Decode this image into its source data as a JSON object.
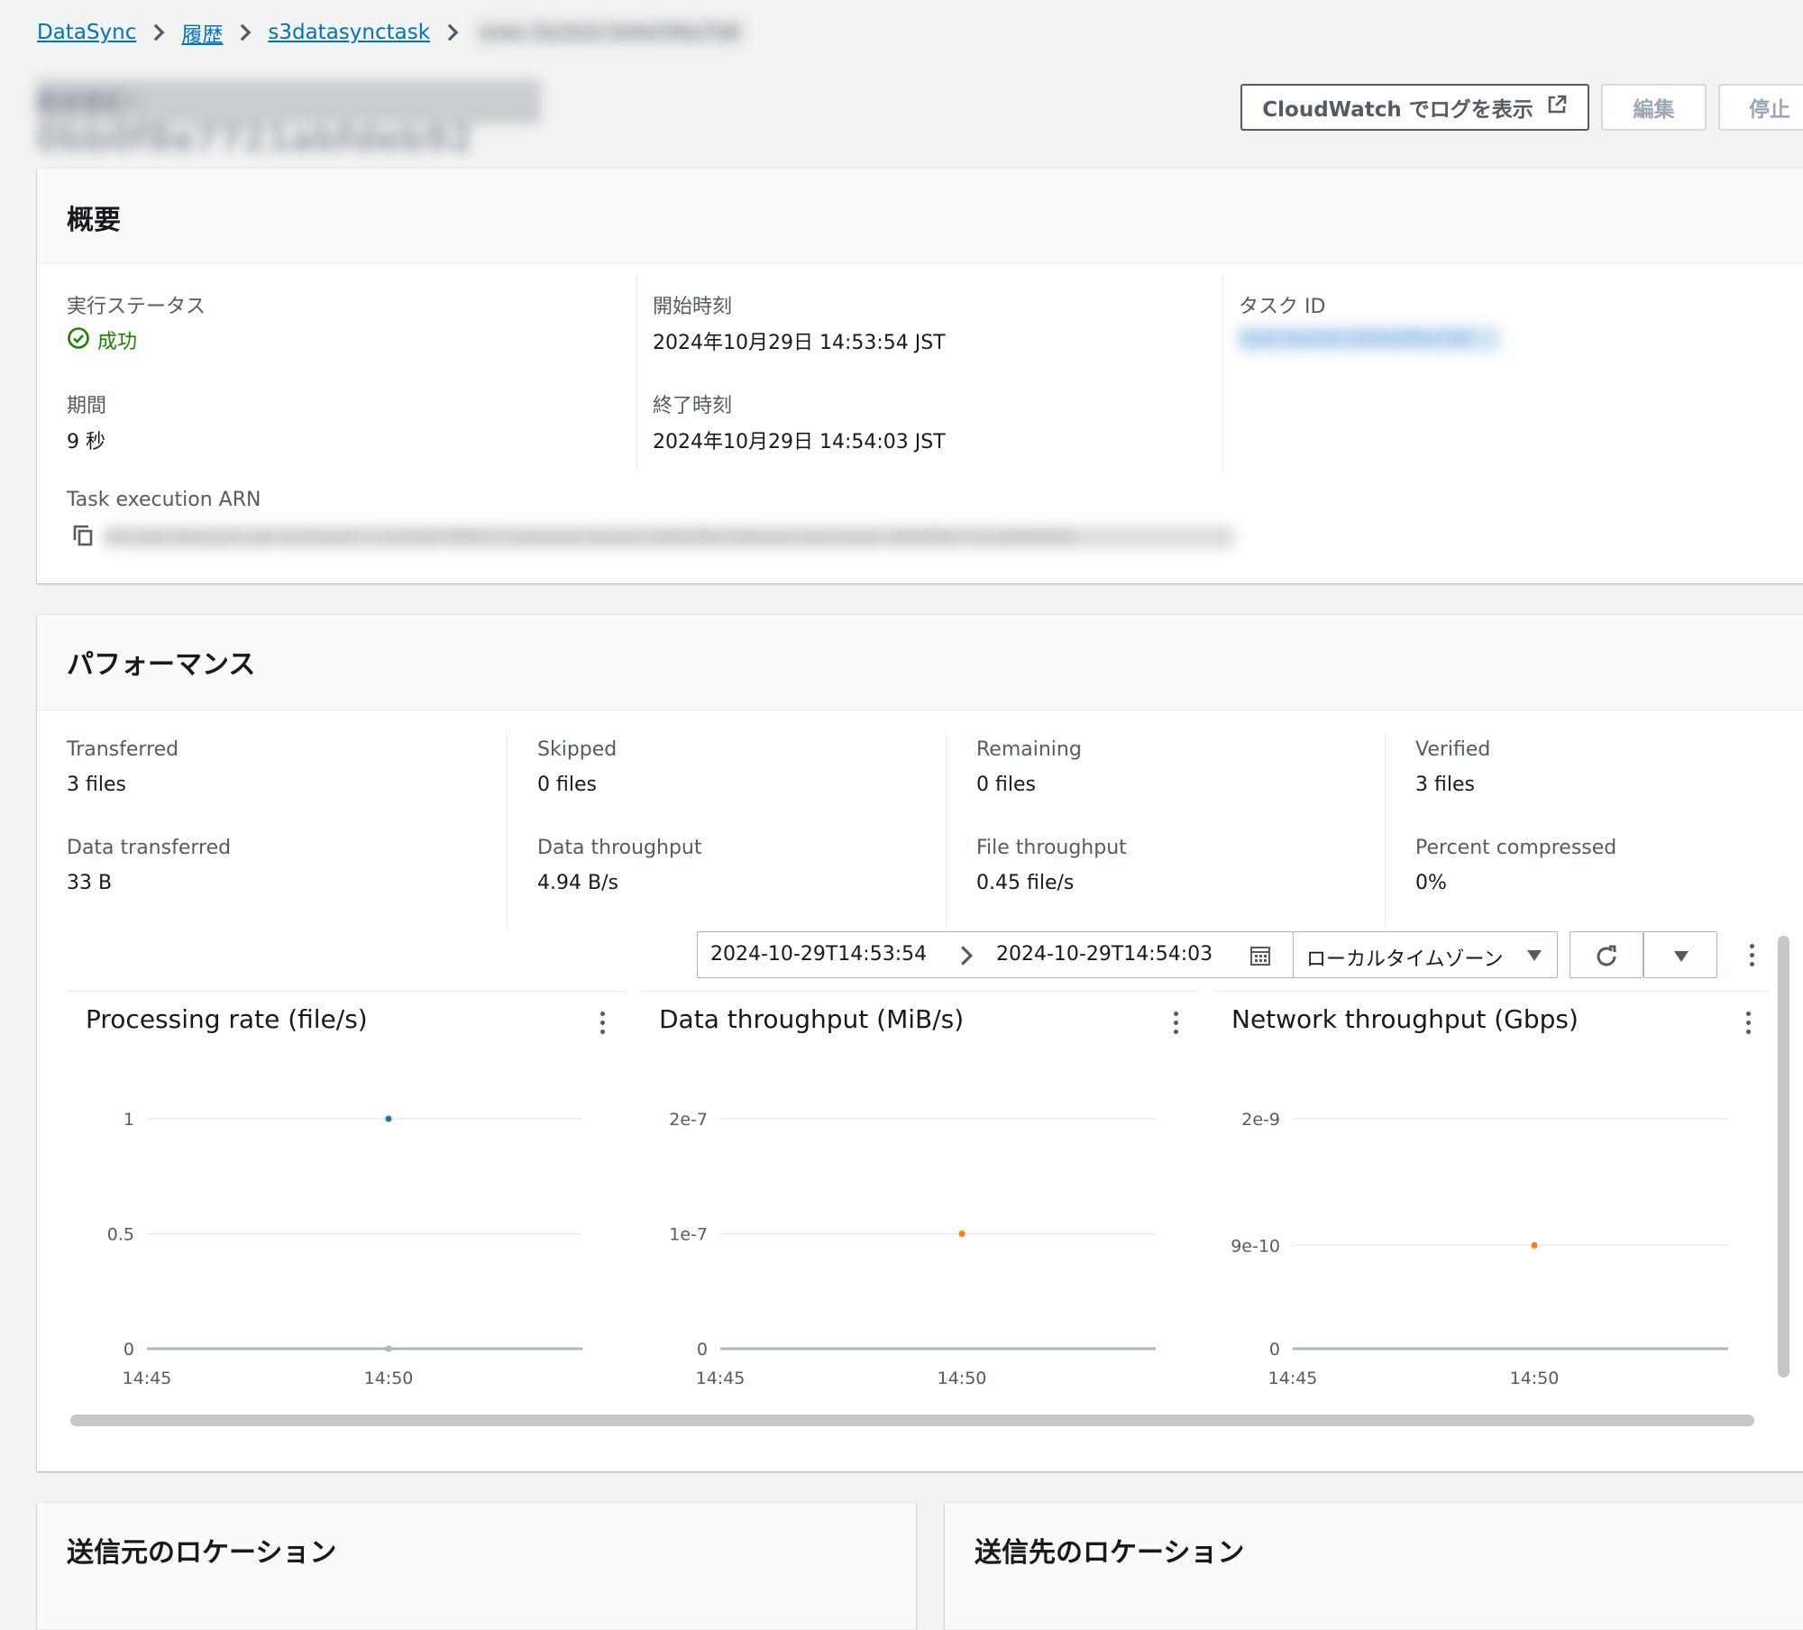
{
  "breadcrumb": {
    "items": [
      "DataSync",
      "履歴",
      "s3datasynctask"
    ],
    "current_redacted": "exec-0a1b2c3d4e5f6a7b8"
  },
  "page": {
    "title_redacted": "exec-0bb0f8e7721abfdeb92"
  },
  "actions": {
    "cloudwatch_label": "CloudWatch でログを表示",
    "edit_label": "編集",
    "stop_label": "停止"
  },
  "overview": {
    "title": "概要",
    "status_label": "実行ステータス",
    "status_value": "成功",
    "duration_label": "期間",
    "duration_value": "9 秒",
    "start_label": "開始時刻",
    "start_value": "2024年10月29日 14:53:54 JST",
    "end_label": "終了時刻",
    "end_value": "2024年10月29日 14:54:03 JST",
    "task_id_label": "タスク ID",
    "task_id_redacted": "task-0a1b2c3d4e5f6a7b8",
    "arn_label": "Task execution ARN",
    "arn_redacted": "arn:aws:datasync:ap-northeast-1:123456789012:task/task-0a1b2c3d4e5f6a7b8/execution/exec-0bb0f8e7721abfdeb92"
  },
  "performance": {
    "title": "パフォーマンス",
    "metrics": [
      {
        "label": "Transferred",
        "value": "3 files"
      },
      {
        "label": "Skipped",
        "value": "0 files"
      },
      {
        "label": "Remaining",
        "value": "0 files"
      },
      {
        "label": "Verified",
        "value": "3 files"
      },
      {
        "label": "Data transferred",
        "value": "33 B"
      },
      {
        "label": "Data throughput",
        "value": "4.94 B/s"
      },
      {
        "label": "File throughput",
        "value": "0.45 file/s"
      },
      {
        "label": "Percent compressed",
        "value": "0%"
      }
    ],
    "range_start": "2024-10-29T14:53:54",
    "range_end": "2024-10-29T14:54:03",
    "timezone": "ローカルタイムゾーン"
  },
  "chart_data": [
    {
      "type": "scatter",
      "title": "Processing rate (file/s)",
      "x_ticks": [
        "14:45",
        "14:50"
      ],
      "y_ticks": [
        "0",
        "0.5",
        "1"
      ],
      "ylim": [
        0,
        1
      ],
      "grid": true,
      "series": [
        {
          "color": "#1f77b4",
          "points": [
            {
              "x": "14:50",
              "y": 1
            }
          ]
        },
        {
          "color": "#aab7b8",
          "points": [
            {
              "x": "14:50",
              "y": 0
            }
          ]
        }
      ]
    },
    {
      "type": "scatter",
      "title": "Data throughput (MiB/s)",
      "x_ticks": [
        "14:45",
        "14:50"
      ],
      "y_ticks": [
        "0",
        "1e-7",
        "2e-7"
      ],
      "ylim": [
        0,
        2e-07
      ],
      "grid": true,
      "series": [
        {
          "color": "#ff7f0e",
          "points": [
            {
              "x": "14:50",
              "y": 1e-07
            }
          ]
        }
      ]
    },
    {
      "type": "scatter",
      "title": "Network throughput (Gbps)",
      "x_ticks": [
        "14:45",
        "14:50"
      ],
      "y_ticks": [
        "0",
        "9e-10",
        "2e-9"
      ],
      "ylim": [
        0,
        2e-09
      ],
      "grid": true,
      "series": [
        {
          "color": "#ff7f0e",
          "points": [
            {
              "x": "14:50",
              "y": 9e-10
            }
          ]
        }
      ]
    }
  ],
  "locations": {
    "source_title": "送信元のロケーション",
    "dest_title": "送信先のロケーション"
  },
  "colors": {
    "link": "#0073bb",
    "success": "#1d8102",
    "series_blue": "#1f77b4",
    "series_orange": "#ff7f0e"
  },
  "icons": [
    "chevron-right-icon",
    "external-link-icon",
    "success-check-icon",
    "copy-icon",
    "calendar-icon",
    "caret-down-icon",
    "refresh-icon",
    "kebab-icon"
  ]
}
